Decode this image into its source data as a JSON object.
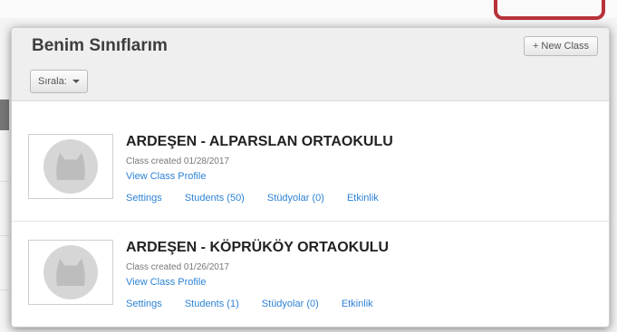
{
  "modal": {
    "title": "Benim Sınıflarım",
    "new_class_label": "+ New Class",
    "sort_label": "Sırala:"
  },
  "classes": [
    {
      "name": "ARDEŞEN - ALPARSLAN ORTAOKULU",
      "created": "Class created 01/28/2017",
      "profile_link": "View Class Profile",
      "settings": "Settings",
      "students": "Students (50)",
      "studios": "Stüdyolar (0)",
      "activity": "Etkinlik"
    },
    {
      "name": "ARDEŞEN - KÖPRÜKÖY ORTAOKULU",
      "created": "Class created 01/26/2017",
      "profile_link": "View Class Profile",
      "settings": "Settings",
      "students": "Students (1)",
      "studios": "Stüdyolar (0)",
      "activity": "Etkinlik"
    }
  ],
  "colors": {
    "link": "#2d83d6",
    "highlight": "#b8323a",
    "header_bg": "#efefef",
    "avatar_circle": "#d6d6d6",
    "avatar_cat": "#bdbdbd"
  },
  "icons": {
    "avatar": "cat-avatar-icon",
    "sort_caret": "caret-down-icon"
  }
}
